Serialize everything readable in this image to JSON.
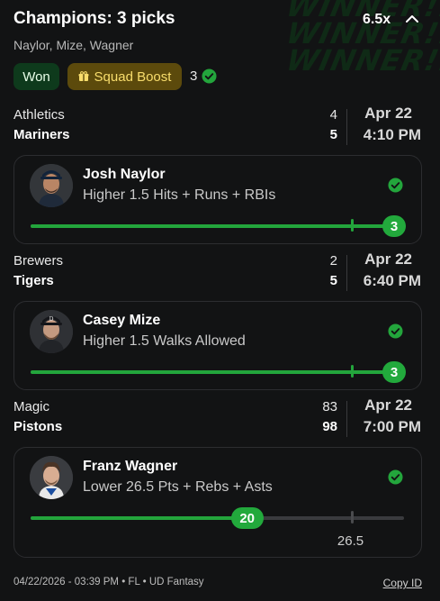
{
  "header": {
    "title": "Champions: 3 picks",
    "multiplier": "6.5x",
    "subtitle": "Naylor, Mize, Wagner",
    "watermark": "WINNER!!"
  },
  "badges": {
    "won": "Won",
    "squad_boost": "Squad Boost",
    "count": "3"
  },
  "games": [
    {
      "team_a": "Athletics",
      "score_a": "4",
      "team_b": "Mariners",
      "score_b": "5",
      "date": "Apr 22",
      "time": "4:10 PM",
      "pick": {
        "player": "Josh Naylor",
        "line": "Higher 1.5 Hits + Runs + RBIs",
        "result": "3",
        "target": "1.5",
        "progress": 1.0,
        "target_fraction": 0.86
      }
    },
    {
      "team_a": "Brewers",
      "score_a": "2",
      "team_b": "Tigers",
      "score_b": "5",
      "date": "Apr 22",
      "time": "6:40 PM",
      "pick": {
        "player": "Casey Mize",
        "line": "Higher 1.5 Walks Allowed",
        "result": "3",
        "target": "1.5",
        "progress": 1.0,
        "target_fraction": 0.86
      }
    },
    {
      "team_a": "Magic",
      "score_a": "83",
      "team_b": "Pistons",
      "score_b": "98",
      "date": "Apr 22",
      "time": "7:00 PM",
      "pick": {
        "player": "Franz Wagner",
        "line": "Lower 26.5 Pts + Rebs + Asts",
        "result": "20",
        "target": "26.5",
        "progress": 0.58,
        "target_fraction": 0.86
      }
    }
  ],
  "footer": {
    "meta": "04/22/2026 - 03:39 PM • FL • UD Fantasy",
    "copy_id": "Copy ID"
  },
  "colors": {
    "accent_green": "#23a53c",
    "won_bg": "#0e3a1c",
    "boost_bg": "#5c4a0c",
    "boost_text": "#f8dd6c",
    "background": "#121314"
  }
}
